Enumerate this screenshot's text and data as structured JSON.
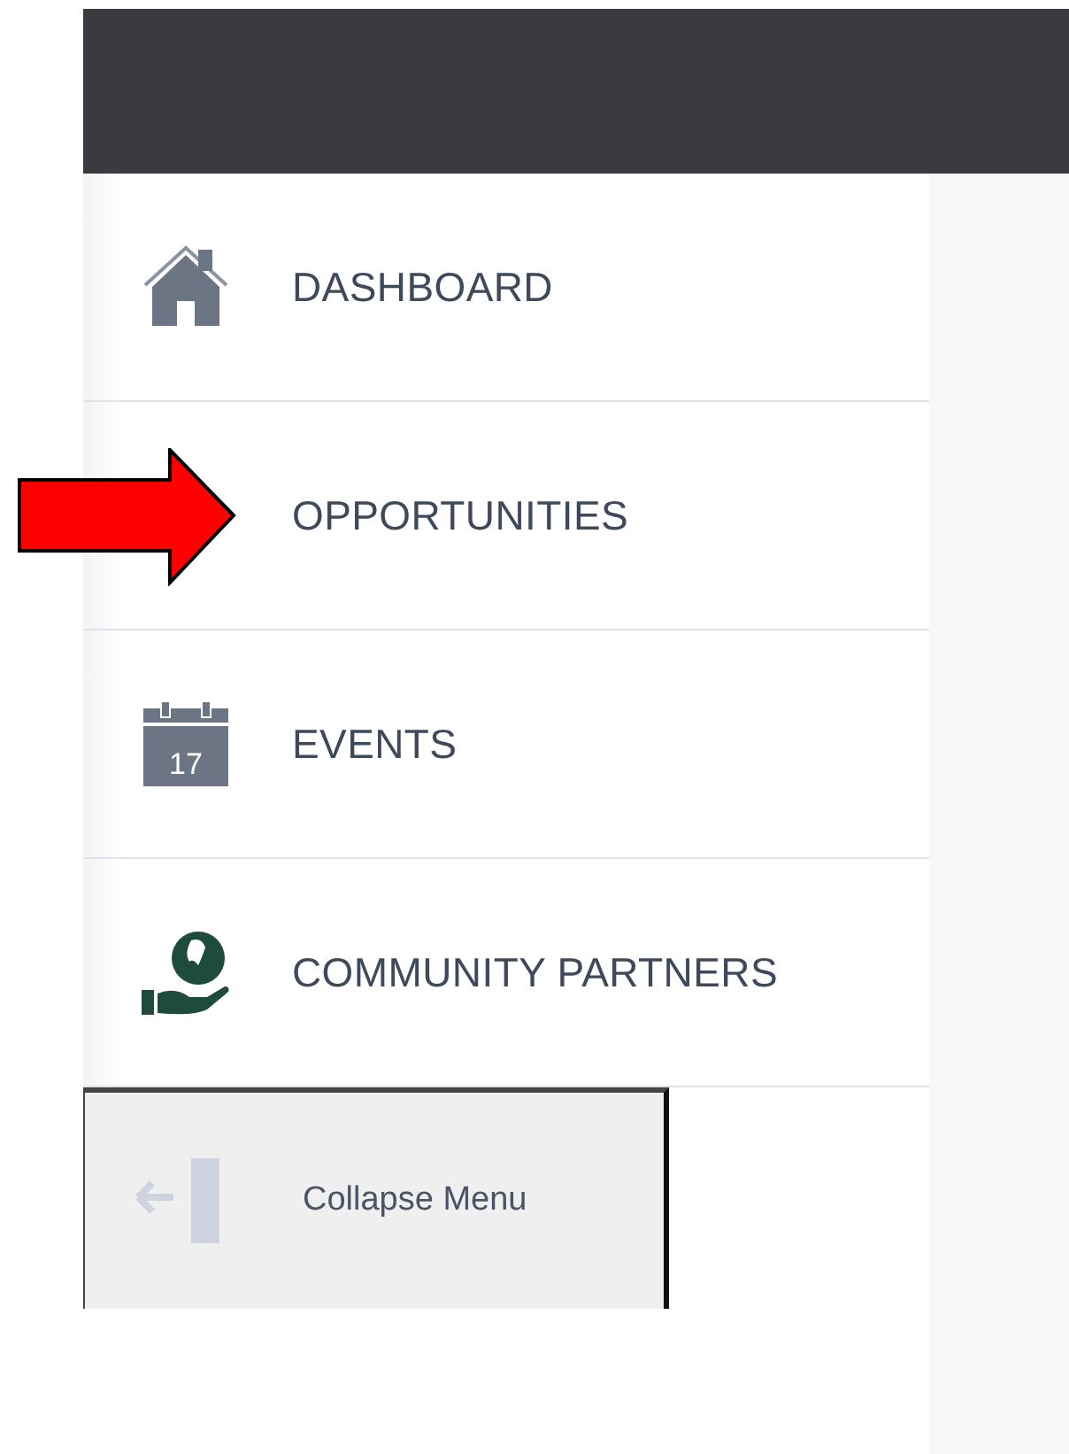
{
  "menu": {
    "items": [
      {
        "kind": "home",
        "label": "DASHBOARD"
      },
      {
        "kind": "none",
        "label": "OPPORTUNITIES"
      },
      {
        "kind": "calendar",
        "label": "EVENTS",
        "icon_text": "17"
      },
      {
        "kind": "globe-hand",
        "label": "COMMUNITY PARTNERS"
      }
    ],
    "collapse_button": {
      "label": "Collapse Menu"
    }
  },
  "annotation": {
    "kind": "arrow",
    "color": "#ff0000"
  }
}
